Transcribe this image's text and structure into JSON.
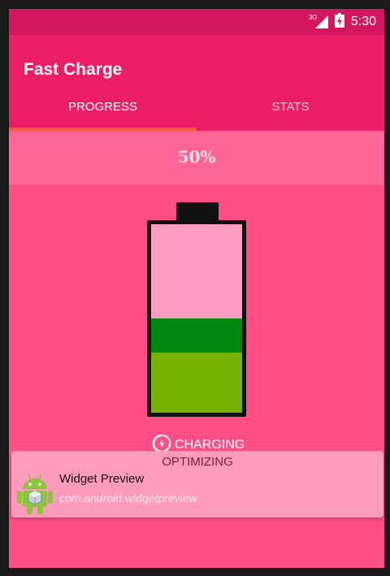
{
  "status_bar": {
    "network": "3G",
    "time": "5:30"
  },
  "app": {
    "title": "Fast Charge"
  },
  "tabs": [
    {
      "label": "PROGRESS",
      "active": true
    },
    {
      "label": "STATS",
      "active": false
    }
  ],
  "battery": {
    "percent_label": "50%",
    "charge_level": 0.5,
    "fast_charge_level": 0.18,
    "status": "CHARGING",
    "icon": "charging-icon"
  },
  "notification": {
    "header": "OPTIMIZING",
    "title": "Widget Preview",
    "subtitle": "com.android.widgetpreview",
    "icon": "android-robot-icon"
  },
  "colors": {
    "status_bar": "#d4165f",
    "app_bar": "#eb1e65",
    "background": "#ff4f86",
    "tab_indicator": "#ff5a40",
    "battery_green_dark": "#00890f",
    "battery_green_light": "#76b100"
  }
}
